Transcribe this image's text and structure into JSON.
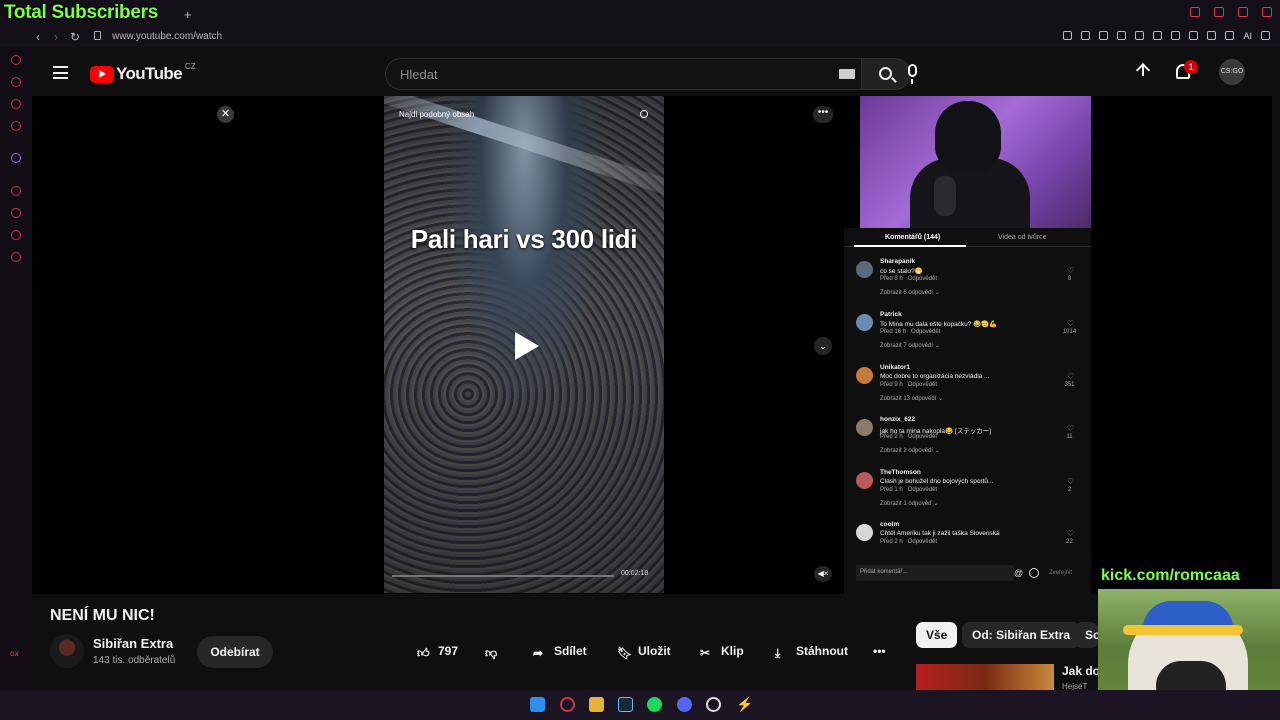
{
  "browser": {
    "overlay_title": "Total Subscribers",
    "url": "www.youtube.com/watch",
    "ai_label": "AI",
    "gx_label": "GX"
  },
  "header": {
    "logo_text": "YouTube",
    "country_code": "CZ",
    "search_placeholder": "Hledat",
    "notification_count": "1",
    "avatar_text": "CS:GO"
  },
  "player": {
    "find_similar": "Najdi podobný obsah",
    "caption": "Pali hari vs 300 lidi",
    "time": "00:02:18"
  },
  "comments_panel": {
    "tabs": [
      {
        "label": "Komentářů (144)"
      },
      {
        "label": "Videa od tvůrce"
      }
    ],
    "comments": [
      {
        "author": "Sharapanik",
        "text": "co se stalo?😁",
        "time": "Před 8 h",
        "reply": "Odpovědět",
        "likes": "8",
        "replies": "Zobrazit 6 odpovědí ⌄",
        "avatar_color": "#5a6b7d"
      },
      {
        "author": "Patrick",
        "text": "To Mina mu dala ešte kopačku? 😂🫡💪",
        "time": "Před 16 h",
        "reply": "Odpovědět",
        "likes": "1014",
        "replies": "Zobrazit 7 odpovědí ⌄",
        "avatar_color": "#6b8db3"
      },
      {
        "author": "Unikator1",
        "text": "Moc dobre to organizácia nezvládla ...",
        "time": "Před 9 h",
        "reply": "Odpovědět",
        "likes": "351",
        "replies": "Zobrazit 13 odpovědí ⌄",
        "avatar_color": "#c47a3a"
      },
      {
        "author": "honzix_622",
        "text": "jak ho ta mina nakopla😂 [ステッカー]",
        "time": "Před 2 h",
        "reply": "Odpovědět",
        "likes": "11",
        "replies": "Zobrazit 2 odpovědí ⌄",
        "avatar_color": "#8a7a6a"
      },
      {
        "author": "TheThomson",
        "text": "Clash je bohužel dno bojových sportů...",
        "time": "Před 1 h",
        "reply": "Odpovědět",
        "likes": "2",
        "replies": "Zobrazit 1 odpověď ⌄",
        "avatar_color": "#b85a5a"
      },
      {
        "author": "coolm",
        "text": "Chtěl Ameriku tak ji zažil taška Slovenská",
        "time": "Před 2 h",
        "reply": "Odpovědět",
        "likes": "22",
        "replies": "",
        "avatar_color": "#d8d8d8"
      }
    ],
    "input_placeholder": "Přidat komentář...",
    "post_label": "Zveřejnit"
  },
  "video": {
    "title": "NENÍ MU NIC!",
    "channel": "Sibiřan Extra",
    "subscribers": "143 tis. odběratelů",
    "subscribe_label": "Odebírat",
    "likes": "797",
    "share_label": "Sdílet",
    "save_label": "Uložit",
    "clip_label": "Klip",
    "download_label": "Stáhnout"
  },
  "chips": [
    {
      "label": "Vše"
    },
    {
      "label": "Od: Sibiřan Extra"
    },
    {
      "label": "So"
    }
  ],
  "related": {
    "title": "Jak dop",
    "subtitle": "HejseT"
  },
  "stream_overlay": {
    "kick_text": "kick.com/romcaaa"
  },
  "colors": {
    "yt_red": "#ff0000",
    "overlay_green": "#7cff4a",
    "browser_accent": "#d2314a"
  }
}
